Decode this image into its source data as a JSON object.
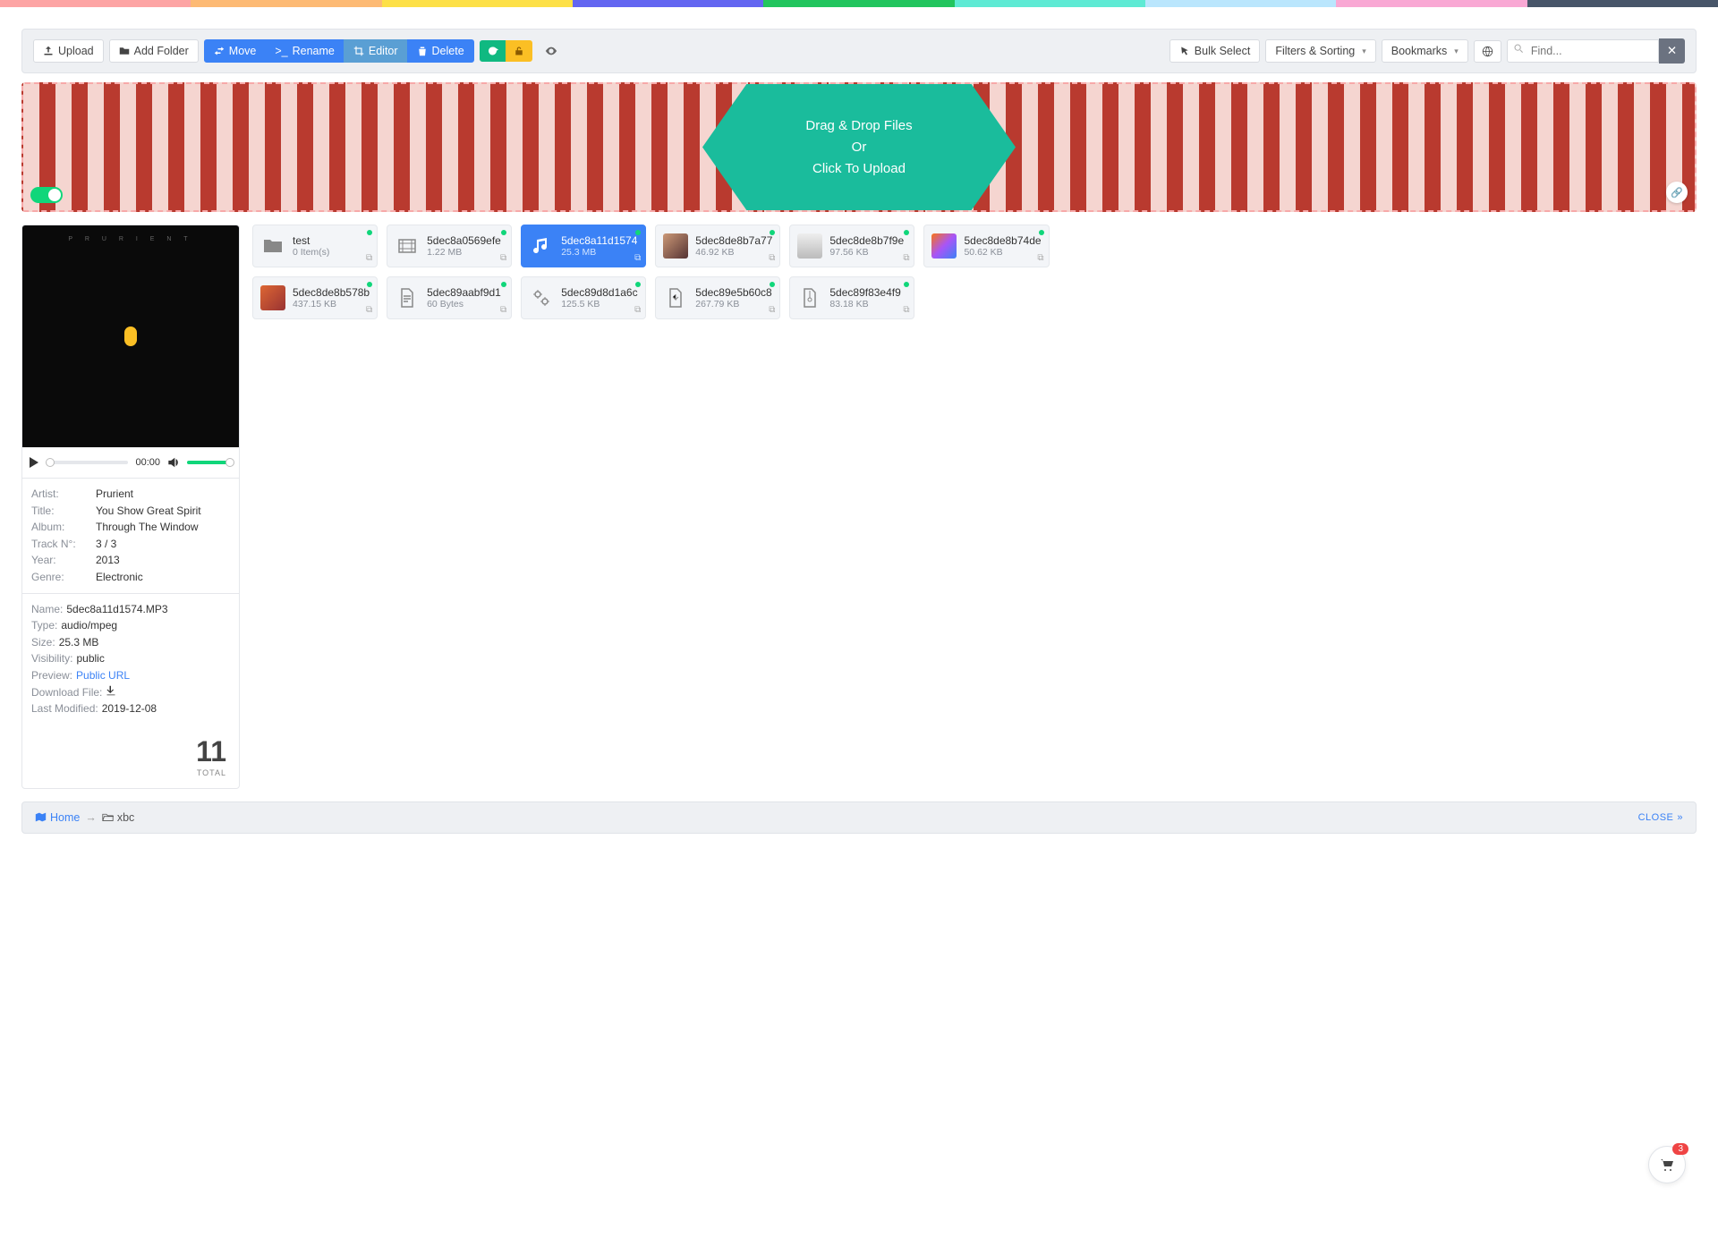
{
  "rainbow": [
    "#fda4a4",
    "#fdba74",
    "#fde047",
    "#6366f1",
    "#22c55e",
    "#5eead4",
    "#bae6fd",
    "#f9a8d4",
    "#475569"
  ],
  "toolbar": {
    "upload": "Upload",
    "add_folder": "Add Folder",
    "move": "Move",
    "rename": "Rename",
    "editor": "Editor",
    "delete": "Delete",
    "bulk_select": "Bulk Select",
    "filters_sorting": "Filters & Sorting",
    "bookmarks": "Bookmarks",
    "search_placeholder": "Find..."
  },
  "dropzone": {
    "line1": "Drag & Drop Files",
    "line2": "Or",
    "line3": "Click To Upload"
  },
  "player": {
    "time": "00:00"
  },
  "meta_music": [
    {
      "label": "Artist:",
      "value": "Prurient"
    },
    {
      "label": "Title:",
      "value": "You Show Great Spirit"
    },
    {
      "label": "Album:",
      "value": "Through The Window"
    },
    {
      "label": "Track N°:",
      "value": "3 / 3"
    },
    {
      "label": "Year:",
      "value": "2013"
    },
    {
      "label": "Genre:",
      "value": "Electronic"
    }
  ],
  "meta_file": [
    {
      "label": "Name:",
      "value": "5dec8a11d1574.MP3"
    },
    {
      "label": "Type:",
      "value": "audio/mpeg"
    },
    {
      "label": "Size:",
      "value": "25.3 MB"
    },
    {
      "label": "Visibility:",
      "value": "public"
    },
    {
      "label": "Preview:",
      "value": "Public URL",
      "link": true
    },
    {
      "label": "Download File:",
      "value": "download",
      "icon": true
    },
    {
      "label": "Last Modified:",
      "value": "2019-12-08"
    }
  ],
  "total": {
    "count": "11",
    "label": "TOTAL"
  },
  "files": [
    {
      "name": "test",
      "size": "0 Item(s)",
      "icon": "folder",
      "selected": false
    },
    {
      "name": "5dec8a0569efe",
      "size": "1.22 MB",
      "icon": "video",
      "selected": false
    },
    {
      "name": "5dec8a11d1574",
      "size": "25.3 MB",
      "icon": "music",
      "selected": true
    },
    {
      "name": "5dec8de8b7a77",
      "size": "46.92 KB",
      "icon": "thumb",
      "thumb": "linear-gradient(135deg,#c97,#533)",
      "selected": false
    },
    {
      "name": "5dec8de8b7f9e",
      "size": "97.56 KB",
      "icon": "thumb",
      "thumb": "linear-gradient(180deg,#eee,#bbb)",
      "selected": false
    },
    {
      "name": "5dec8de8b74de",
      "size": "50.62 KB",
      "icon": "thumb",
      "thumb": "linear-gradient(135deg,#f97316,#a855f7,#3b82f6)",
      "selected": false
    },
    {
      "name": "5dec8de8b578b",
      "size": "437.15 KB",
      "icon": "thumb",
      "thumb": "linear-gradient(135deg,#d63,#933)",
      "selected": false
    },
    {
      "name": "5dec89aabf9d1",
      "size": "60 Bytes",
      "icon": "doc",
      "selected": false
    },
    {
      "name": "5dec89d8d1a6c",
      "size": "125.5 KB",
      "icon": "gears",
      "selected": false
    },
    {
      "name": "5dec89e5b60c8",
      "size": "267.79 KB",
      "icon": "pdf",
      "selected": false
    },
    {
      "name": "5dec89f83e4f9",
      "size": "83.18 KB",
      "icon": "zip",
      "selected": false
    }
  ],
  "breadcrumb": {
    "home": "Home",
    "current": "xbc",
    "close": "CLOSE"
  },
  "cart_count": "3"
}
